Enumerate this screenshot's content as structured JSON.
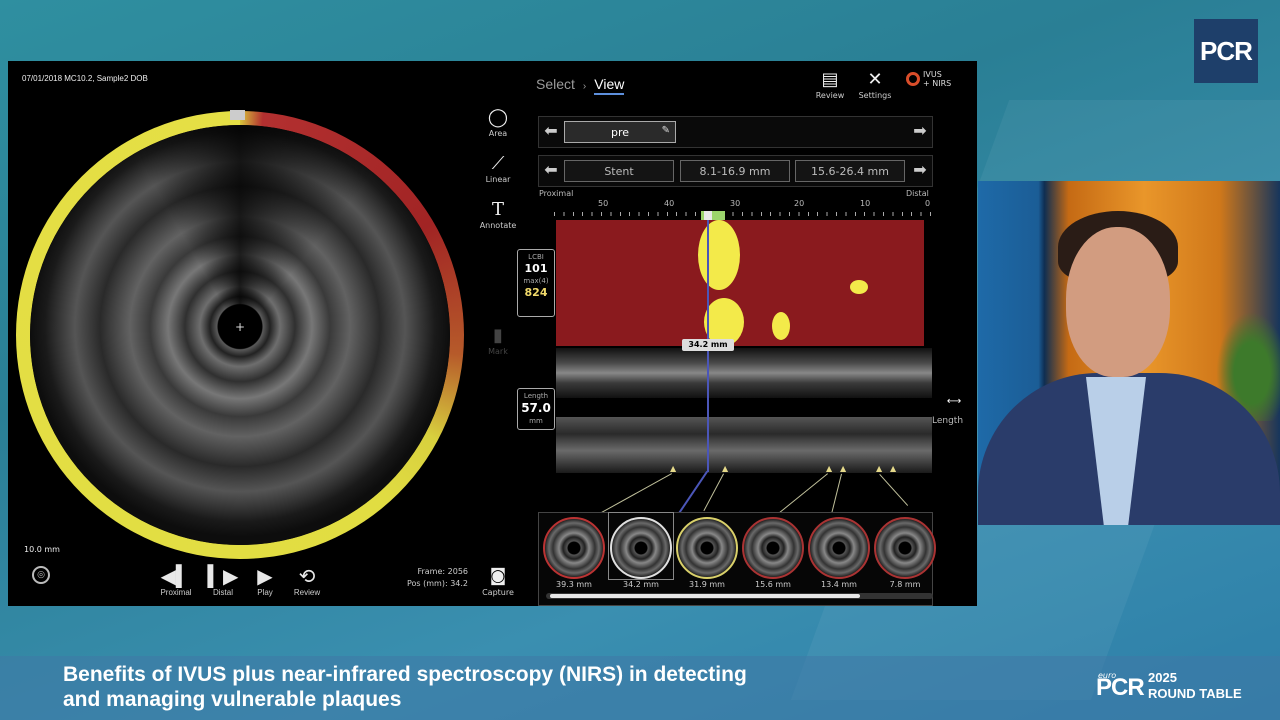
{
  "branding": {
    "logo": "PCR",
    "event_prefix": "euro",
    "event_logo": "PCR",
    "event_year": "2025",
    "event_name": "ROUND TABLE"
  },
  "caption": {
    "line1": "Benefits of IVUS plus near-infrared spectroscopy (NIRS) in detecting",
    "line2": "and managing vulnerable plaques"
  },
  "ivus_app": {
    "header_text": "07/01/2018  MC10.2, Sample2  DOB",
    "nav": {
      "select": "Select",
      "separator": "›",
      "view": "View"
    },
    "top_icons": [
      {
        "label": "Review",
        "icon": "review-icon"
      },
      {
        "label": "Settings",
        "icon": "settings-icon"
      }
    ],
    "brand": {
      "line1": "IVUS",
      "line2": "+ NIRS"
    },
    "tools": [
      {
        "label": "Area",
        "icon": "area-icon"
      },
      {
        "label": "Linear",
        "icon": "linear-icon"
      },
      {
        "label": "Annotate",
        "icon": "annotate-icon",
        "glyph": "T"
      },
      {
        "label": "Mark",
        "icon": "mark-icon"
      }
    ],
    "pullback_row1": {
      "selected": "pre"
    },
    "pullback_row2": {
      "items": [
        "Stent",
        "8.1-16.9 mm",
        "15.6-26.4 mm"
      ]
    },
    "ruler": {
      "proximal": "Proximal",
      "distal": "Distal",
      "ticks": [
        "50",
        "40",
        "30",
        "20",
        "10",
        "0"
      ]
    },
    "lcbi": {
      "label": "LCBI",
      "value": "101",
      "max_label": "max(4)",
      "max_value": "824"
    },
    "current_pos": "34.2 mm",
    "length": {
      "label": "Length",
      "value": "57.0",
      "unit": "mm",
      "side_label": "Length"
    },
    "scale_label": "10.0 mm",
    "playback": [
      {
        "label": "Proximal",
        "glyph": "◀▍"
      },
      {
        "label": "Distal",
        "glyph": "▍▶"
      },
      {
        "label": "Play",
        "glyph": "▶"
      },
      {
        "label": "Review",
        "glyph": "⟲"
      }
    ],
    "frame": {
      "frame_label": "Frame:",
      "frame_value": "2056",
      "pos_label": "Pos (mm):",
      "pos_value": "34.2"
    },
    "capture_label": "Capture",
    "thumbnails": [
      "39.3 mm",
      "34.2 mm",
      "31.9 mm",
      "15.6 mm",
      "13.4 mm",
      "7.8 mm"
    ]
  }
}
